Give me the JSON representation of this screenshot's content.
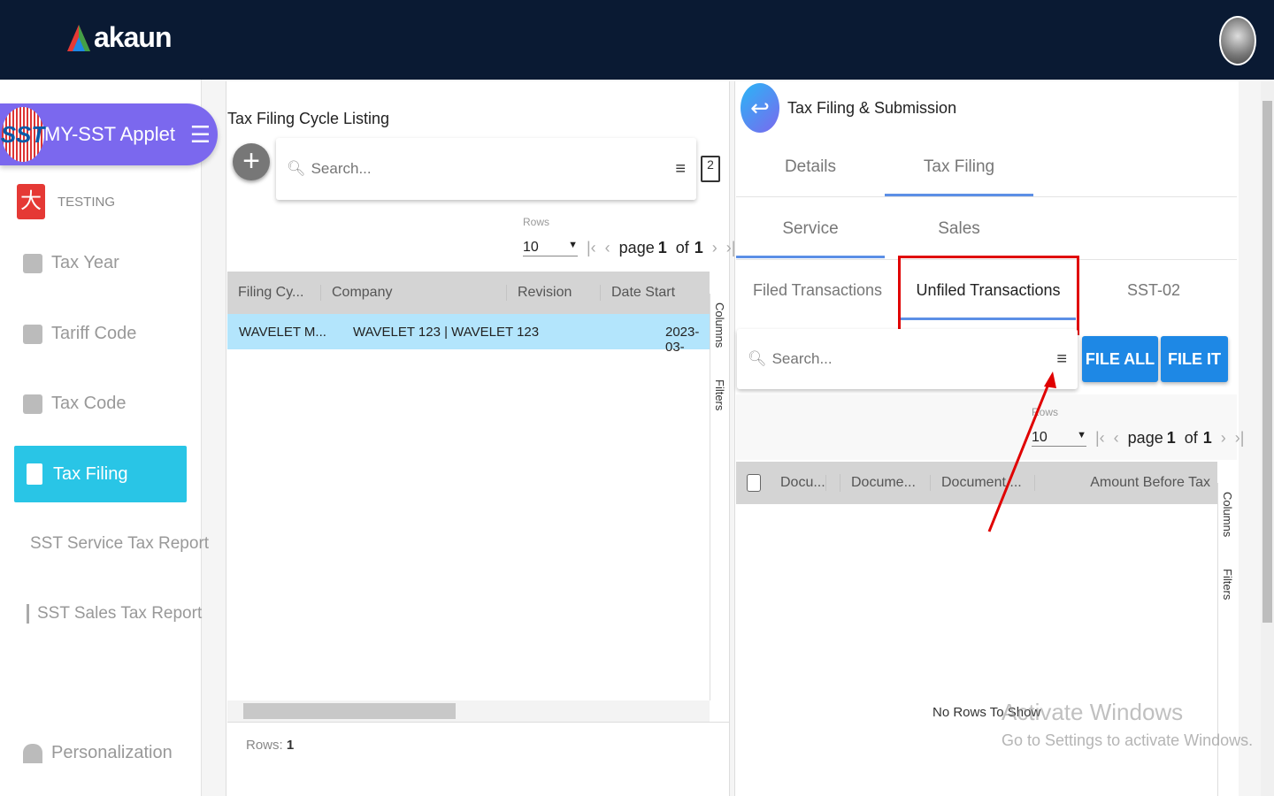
{
  "header": {
    "brand": "akaun"
  },
  "sidebar": {
    "applet": "MY-SST Applet",
    "org": "TESTING",
    "items": [
      {
        "label": "Tax Year"
      },
      {
        "label": "Tariff Code"
      },
      {
        "label": "Tax Code"
      },
      {
        "label": "Tax Filing"
      },
      {
        "label": "SST Service Tax Report"
      },
      {
        "label": "SST Sales Tax Report"
      }
    ],
    "personalization": "Personalization"
  },
  "listing": {
    "title": "Tax Filing Cycle Listing",
    "search_placeholder": "Search...",
    "rows_label": "Rows",
    "rows_value": "10",
    "page_word": "page",
    "page": "1",
    "of_word": "of",
    "total_pages": "1",
    "columns": [
      "Filing Cy...",
      "Company",
      "Revision",
      "Date Start"
    ],
    "rows": [
      {
        "filing_cycle": "WAVELET M...",
        "company": "WAVELET 123 | WAVELET 123",
        "revision": "",
        "date_start": "2023-03-"
      }
    ],
    "columns_tool": "Columns",
    "filters_tool": "Filters",
    "footer_label": "Rows:",
    "footer_count": "1"
  },
  "detail": {
    "title": "Tax Filing & Submission",
    "tabs1": [
      "Details",
      "Tax Filing"
    ],
    "tabs2": [
      "Service",
      "Sales"
    ],
    "tabs3": [
      "Filed Transactions",
      "Unfiled Transactions",
      "SST-02"
    ],
    "search_placeholder": "Search...",
    "file_all": "FILE ALL",
    "file_it": "FILE IT",
    "rows_label": "Rows",
    "rows_value": "10",
    "page_word": "page",
    "page": "1",
    "of_word": "of",
    "total_pages": "1",
    "columns": [
      "Docu...",
      "Docume...",
      "Document ...",
      "Amount Before Tax"
    ],
    "empty": "No Rows To Show",
    "columns_tool": "Columns",
    "filters_tool": "Filters"
  },
  "watermark": {
    "line1": "Activate Windows",
    "line2": "Go to Settings to activate Windows."
  },
  "colors": {
    "header": "#0a1a33",
    "applet": "#7b68ee",
    "active": "#29c5e6",
    "button": "#1e88e5",
    "highlight": "#e00000",
    "selected_row": "#b3e5fc"
  }
}
